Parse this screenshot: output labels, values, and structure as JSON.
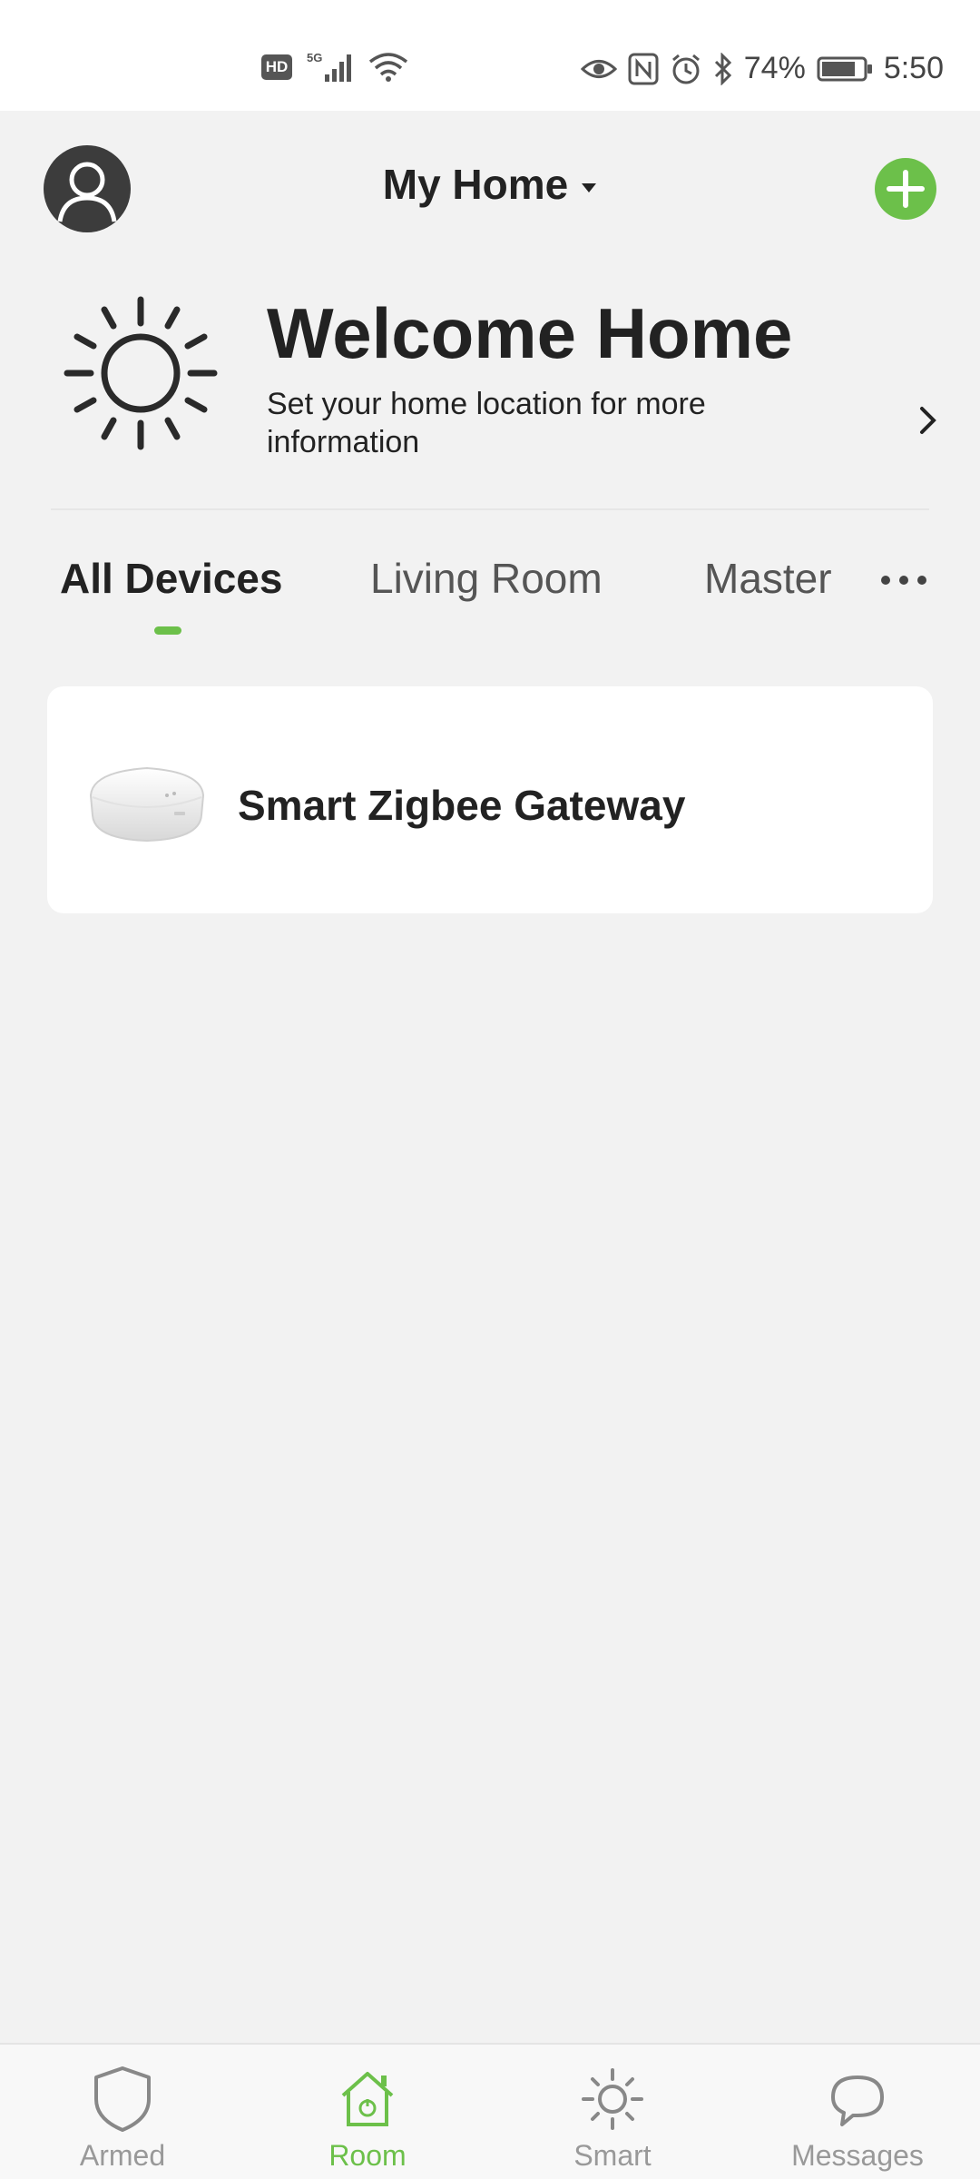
{
  "status_bar": {
    "hd_badge": "HD",
    "network": "5G",
    "battery_percent": "74%",
    "time": "5:50",
    "icons": [
      "hd-icon",
      "signal-icon",
      "wifi-icon",
      "eye-icon",
      "nfc-icon",
      "alarm-icon",
      "bluetooth-icon",
      "battery-icon"
    ]
  },
  "header": {
    "home_name": "My Home",
    "avatar_icon": "user-icon",
    "add_icon": "plus-icon"
  },
  "welcome": {
    "title": "Welcome Home",
    "subtitle": "Set your home location for more information",
    "icon": "sun-icon"
  },
  "tabs": [
    {
      "label": "All Devices",
      "active": true
    },
    {
      "label": "Living Room",
      "active": false
    },
    {
      "label": "Master",
      "active": false
    }
  ],
  "devices": [
    {
      "name": "Smart Zigbee Gateway",
      "icon": "zigbee-gateway-image"
    }
  ],
  "bottom_nav": [
    {
      "label": "Armed",
      "icon": "shield-icon",
      "active": false
    },
    {
      "label": "Room",
      "icon": "house-icon",
      "active": true
    },
    {
      "label": "Smart",
      "icon": "sun-icon",
      "active": false
    },
    {
      "label": "Messages",
      "icon": "chat-bubble-icon",
      "active": false
    }
  ],
  "colors": {
    "accent": "#6cc04a",
    "background": "#f2f2f2",
    "card": "#ffffff",
    "text": "#222222",
    "inactive_nav": "#999999"
  }
}
